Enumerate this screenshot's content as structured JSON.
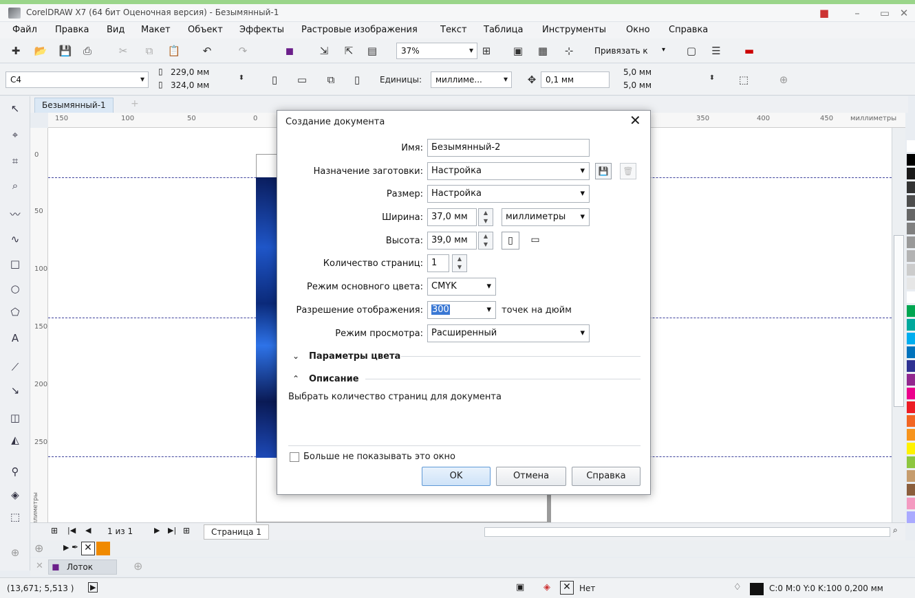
{
  "window": {
    "title": "CorelDRAW X7 (64 бит Оценочная версия) - Безымянный-1"
  },
  "menubar": {
    "items": [
      "Файл",
      "Правка",
      "Вид",
      "Макет",
      "Объект",
      "Эффекты",
      "Растровые изображения",
      "Текст",
      "Таблица",
      "Инструменты",
      "Окно",
      "Справка"
    ]
  },
  "toolbar": {
    "zoom": "37%",
    "snap": "Привязать к"
  },
  "propbar": {
    "page_size": "C4",
    "width": "229,0 мм",
    "height": "324,0 мм",
    "units_label": "Единицы:",
    "units": "миллиме...",
    "nudge": "0,1 мм",
    "dup_x": "5,0 мм",
    "dup_y": "5,0 мм"
  },
  "doc": {
    "tab": "Безымянный-1",
    "ruler_units": "миллиметры",
    "hticks": [
      "150",
      "100",
      "50",
      "0",
      "350",
      "400",
      "450"
    ],
    "vticks": [
      "0",
      "50",
      "100",
      "150",
      "200",
      "250"
    ],
    "vunits": "миллиметры"
  },
  "nav": {
    "page_count": "1 из 1",
    "page_tab": "Страница 1"
  },
  "tray": {
    "label": "Лоток"
  },
  "status": {
    "coords": "(13,671; 5,513 )",
    "fill": "Нет",
    "outline": "C:0 M:0 Y:0 K:100  0,200 мм"
  },
  "dialog": {
    "title": "Создание документа",
    "name_label": "Имя:",
    "name_value": "Безымянный-2",
    "preset_label": "Назначение заготовки:",
    "preset_value": "Настройка",
    "size_label": "Размер:",
    "size_value": "Настройка",
    "width_label": "Ширина:",
    "width_value": "37,0 мм",
    "units_value": "миллиметры",
    "height_label": "Высота:",
    "height_value": "39,0 мм",
    "pages_label": "Количество страниц:",
    "pages_value": "1",
    "color_label": "Режим основного цвета:",
    "color_value": "CMYK",
    "res_label": "Разрешение отображения:",
    "res_value": "300",
    "res_unit": "точек на дюйм",
    "view_label": "Режим просмотра:",
    "view_value": "Расширенный",
    "color_params": "Параметры цвета",
    "desc_heading": "Описание",
    "desc_text": "Выбрать количество страниц для документа",
    "dont_show": "Больше не показывать это окно",
    "ok": "OK",
    "cancel": "Отмена",
    "help": "Справка"
  },
  "palette": [
    "#ffffff",
    "#000000",
    "#1a1a1a",
    "#333333",
    "#4d4d4d",
    "#666666",
    "#808080",
    "#999999",
    "#b3b3b3",
    "#cccccc",
    "#e6e6e6",
    "#ffffff",
    "#00a651",
    "#00a99d",
    "#00aeef",
    "#0072bc",
    "#2e3192",
    "#92278f",
    "#ec008c",
    "#ed1c24",
    "#f26522",
    "#f7941d",
    "#fff200",
    "#8dc63f",
    "#c69c6d",
    "#8b5e3c",
    "#f49ac1",
    "#aaaaff"
  ]
}
